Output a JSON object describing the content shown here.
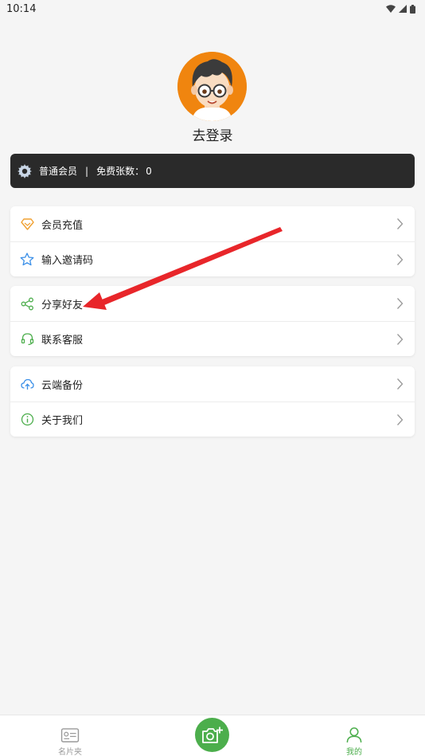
{
  "status_bar": {
    "time": "10:14"
  },
  "profile": {
    "login_label": "去登录"
  },
  "member": {
    "level": "普通会员",
    "separator": "|",
    "free_count_label": "免费张数：",
    "free_count": "0"
  },
  "menu_group_1": [
    {
      "label": "会员充值",
      "icon": "diamond-icon"
    },
    {
      "label": "输入邀请码",
      "icon": "star-icon"
    }
  ],
  "menu_group_2": [
    {
      "label": "分享好友",
      "icon": "share-icon"
    },
    {
      "label": "联系客服",
      "icon": "headset-icon"
    }
  ],
  "menu_group_3": [
    {
      "label": "云端备份",
      "icon": "cloud-upload-icon"
    },
    {
      "label": "关于我们",
      "icon": "info-icon"
    }
  ],
  "bottom_nav": {
    "left_label": "名片夹",
    "right_label": "我的"
  },
  "colors": {
    "accent": "#4cae4c",
    "avatar_bg": "#f0850f",
    "member_bar_bg": "#2a2a2a",
    "arrow": "#e8262a"
  }
}
